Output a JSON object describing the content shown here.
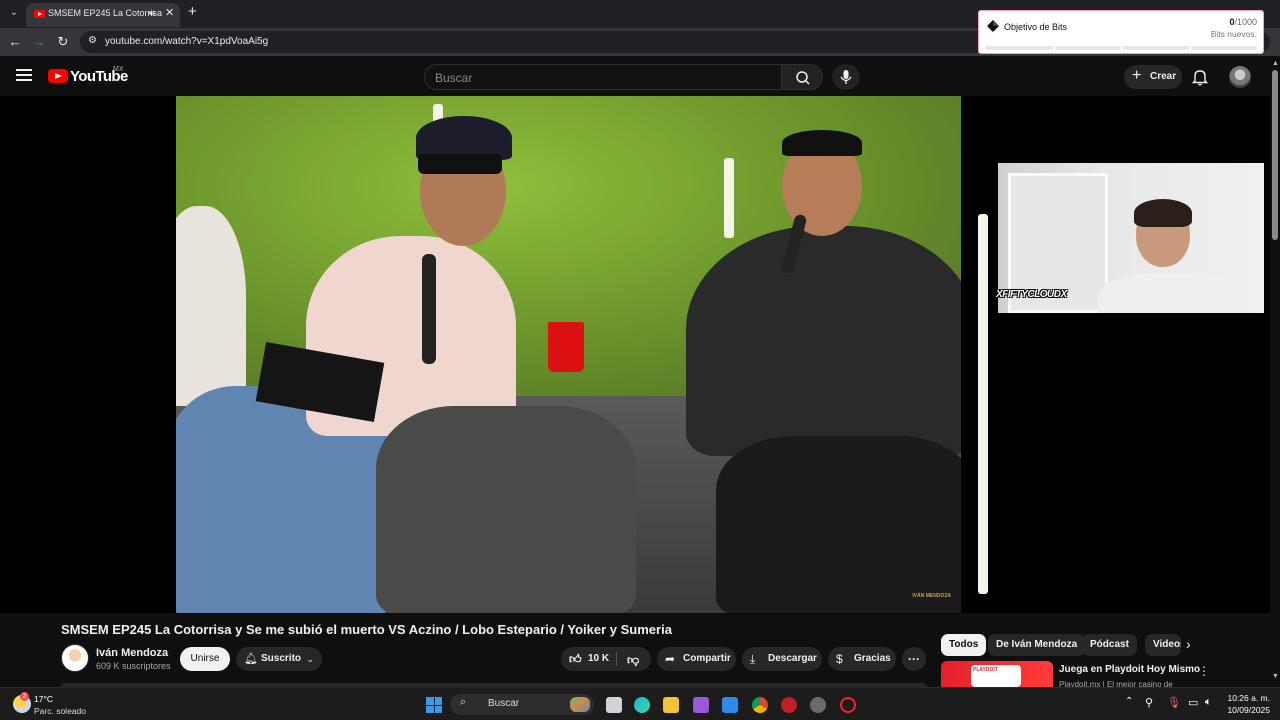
{
  "browser": {
    "tab_title": "SMSEM EP245 La Cotorrisa",
    "url": "youtube.com/watch?v=X1pdVoaAi5g",
    "new_tab_label": "+"
  },
  "bits_overlay": {
    "label": "Objetivo de Bits",
    "current": "0",
    "goal": "/1000",
    "subtitle": "Bits nuevos.",
    "progress_fraction": 0
  },
  "youtube": {
    "logo_text": "YouTube",
    "country_code": "MX",
    "search_placeholder": "Buscar",
    "create_label": "Crear"
  },
  "video": {
    "title": "SMSEM EP245 La Cotorrisa y Se me subió el muerto VS Aczino / Lobo Estepario / Yoiker y Sumeria",
    "webcam_tag": "XFIFTYCLOUDX",
    "corner_logo": "IVÁN MENDOZA"
  },
  "channel": {
    "name": "Iván Mendoza",
    "subscribers": "609 K suscriptores",
    "join_label": "Unirse",
    "subscribed_label": "Suscrito"
  },
  "actions": {
    "likes": "10 K",
    "share": "Compartir",
    "download": "Descargar",
    "thanks": "Gracias",
    "more": "···"
  },
  "chips": [
    "Todos",
    "De Iván Mendoza",
    "Pódcast",
    "Videos"
  ],
  "sidebar_ad": {
    "title": "Juega en Playdoit Hoy Mismo",
    "subtitle": "Playdoit.mx | El mejor casino de",
    "thumb_text": "PLAYDOIT"
  },
  "taskbar": {
    "weather_badge": "2",
    "temperature": "17°C",
    "weather": "Parc. soleado",
    "search_label": "Buscar",
    "time": "10:26 a. m.",
    "date": "10/09/2025"
  },
  "colors": {
    "yt_red": "#ff0000",
    "bg": "#0f0f0f",
    "chip": "#272727",
    "win_accent": "#3a9bea"
  }
}
